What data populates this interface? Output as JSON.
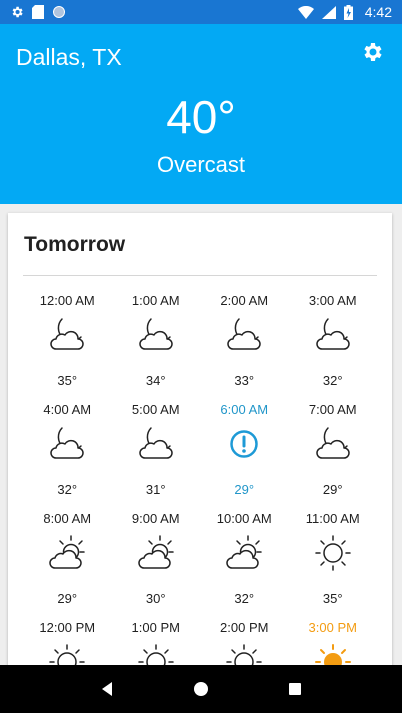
{
  "status_bar": {
    "time": "4:42"
  },
  "header": {
    "city": "Dallas, TX",
    "temperature": "40°",
    "condition": "Overcast"
  },
  "forecast": {
    "title": "Tomorrow",
    "hours": [
      {
        "time": "12:00 AM",
        "temp": "35°",
        "icon": "moon-cloud-icon",
        "state": ""
      },
      {
        "time": "1:00 AM",
        "temp": "34°",
        "icon": "moon-cloud-icon",
        "state": ""
      },
      {
        "time": "2:00 AM",
        "temp": "33°",
        "icon": "moon-cloud-icon",
        "state": ""
      },
      {
        "time": "3:00 AM",
        "temp": "32°",
        "icon": "moon-cloud-icon",
        "state": ""
      },
      {
        "time": "4:00 AM",
        "temp": "32°",
        "icon": "moon-cloud-icon",
        "state": ""
      },
      {
        "time": "5:00 AM",
        "temp": "31°",
        "icon": "moon-cloud-icon",
        "state": ""
      },
      {
        "time": "6:00 AM",
        "temp": "29°",
        "icon": "alert-circle-icon",
        "state": "now"
      },
      {
        "time": "7:00 AM",
        "temp": "29°",
        "icon": "moon-cloud-icon",
        "state": ""
      },
      {
        "time": "8:00 AM",
        "temp": "29°",
        "icon": "sun-cloud-icon",
        "state": ""
      },
      {
        "time": "9:00 AM",
        "temp": "30°",
        "icon": "sun-cloud-icon",
        "state": ""
      },
      {
        "time": "10:00 AM",
        "temp": "32°",
        "icon": "sun-cloud-icon",
        "state": ""
      },
      {
        "time": "11:00 AM",
        "temp": "35°",
        "icon": "sun-icon",
        "state": ""
      },
      {
        "time": "12:00 PM",
        "temp": "",
        "icon": "sun-icon",
        "state": ""
      },
      {
        "time": "1:00 PM",
        "temp": "",
        "icon": "sun-icon",
        "state": ""
      },
      {
        "time": "2:00 PM",
        "temp": "",
        "icon": "sun-icon",
        "state": ""
      },
      {
        "time": "3:00 PM",
        "temp": "",
        "icon": "sun-icon",
        "state": "hot"
      }
    ]
  },
  "colors": {
    "header_bg": "#03a9f4",
    "status_bg": "#1976d2",
    "now": "#2196c9",
    "hot": "#f39c12"
  }
}
